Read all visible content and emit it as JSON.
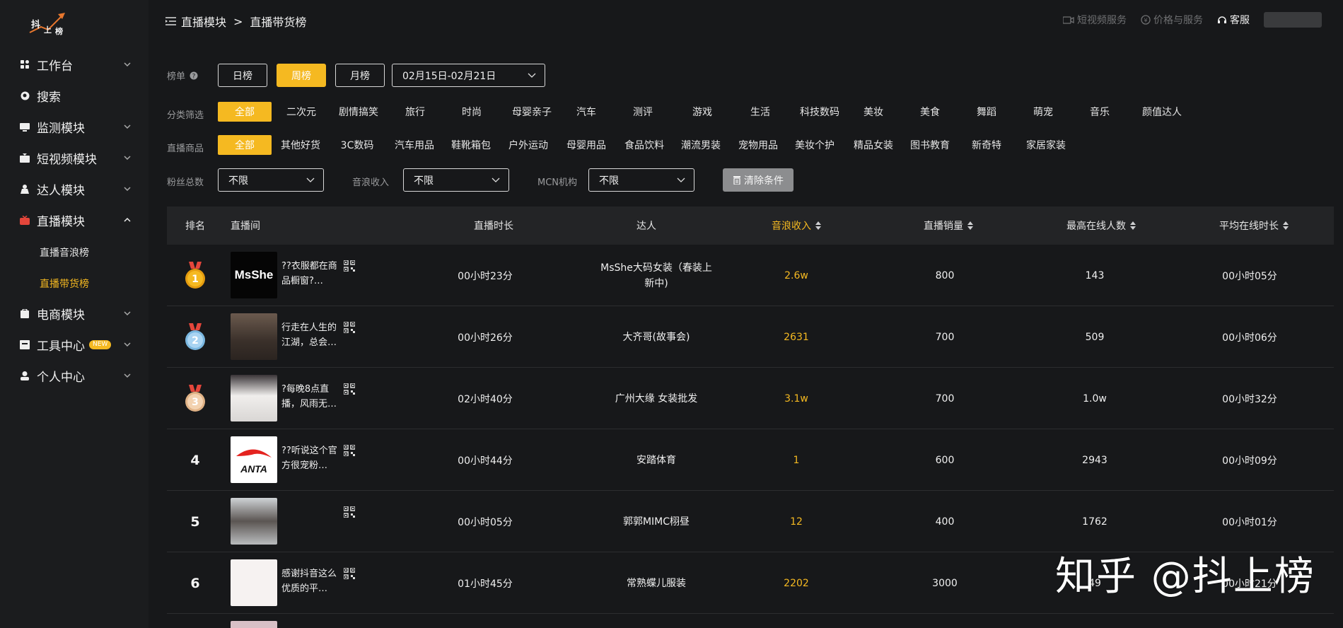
{
  "logo": {
    "line1": "抖",
    "line2": "上",
    "line3": "榜"
  },
  "sidebar": {
    "items": [
      {
        "label": "工作台",
        "icon": "grid-icon",
        "expanded": false
      },
      {
        "label": "搜索",
        "icon": "search-icon"
      },
      {
        "label": "监测模块",
        "icon": "monitor-icon",
        "expanded": false
      },
      {
        "label": "短视频模块",
        "icon": "video-icon",
        "expanded": false
      },
      {
        "label": "达人模块",
        "icon": "person-icon",
        "expanded": false
      },
      {
        "label": "直播模块",
        "icon": "tv-icon",
        "expanded": true
      },
      {
        "label": "电商模块",
        "icon": "shop-icon",
        "expanded": false
      },
      {
        "label": "工具中心",
        "icon": "tool-icon",
        "badge": "NEW",
        "expanded": false
      },
      {
        "label": "个人中心",
        "icon": "user-icon",
        "expanded": false
      }
    ],
    "subitems": [
      {
        "label": "直播音浪榜",
        "active": false
      },
      {
        "label": "直播带货榜",
        "active": true
      }
    ]
  },
  "header": {
    "breadcrumb": [
      "直播模块",
      "直播带货榜"
    ],
    "separator": ">",
    "links": [
      {
        "label": "短视频服务",
        "icon": "camera-icon"
      },
      {
        "label": "价格与服务",
        "icon": "yen-icon"
      },
      {
        "label": "客服",
        "icon": "headset-icon"
      }
    ]
  },
  "filters": {
    "board_label": "榜单",
    "periods": [
      {
        "label": "日榜",
        "active": false
      },
      {
        "label": "周榜",
        "active": true
      },
      {
        "label": "月榜",
        "active": false
      }
    ],
    "date_range": "02月15日-02月21日",
    "category_label": "分类筛选",
    "categories": [
      "全部",
      "二次元",
      "剧情搞笑",
      "旅行",
      "时尚",
      "母婴亲子",
      "汽车",
      "测评",
      "游戏",
      "生活",
      "科技数码",
      "美妆",
      "美食",
      "舞蹈",
      "萌宠",
      "音乐",
      "颜值达人"
    ],
    "goods_label": "直播商品",
    "goods": [
      "全部",
      "其他好货",
      "3C数码",
      "汽车用品",
      "鞋靴箱包",
      "户外运动",
      "母婴用品",
      "食品饮料",
      "潮流男装",
      "宠物用品",
      "美妆个护",
      "精品女装",
      "图书教育",
      "新奇特",
      "家居家装"
    ],
    "fans_label": "粉丝总数",
    "fans_value": "不限",
    "income_label": "音浪收入",
    "income_value": "不限",
    "mcn_label": "MCN机构",
    "mcn_value": "不限",
    "clear_label": "清除条件"
  },
  "table": {
    "columns": [
      "排名",
      "直播间",
      "直播时长",
      "达人",
      "音浪收入",
      "直播销量",
      "最高在线人数",
      "平均在线时长"
    ],
    "sorted_column": "音浪收入",
    "rows": [
      {
        "rank": "1",
        "medal": "gold",
        "title": "??衣服都在商品橱窗?…",
        "duration": "00小时23分",
        "streamer": "MsShe大码女装（春装上新中)",
        "income": "2.6w",
        "sales": "800",
        "peak": "143",
        "avg": "00小时05分",
        "thumb_text": "MsShe"
      },
      {
        "rank": "2",
        "medal": "silver",
        "title": "行走在人生的江湖，总会…",
        "duration": "00小时26分",
        "streamer": "大齐哥(故事会)",
        "income": "2631",
        "sales": "700",
        "peak": "509",
        "avg": "00小时06分",
        "thumb_text": ""
      },
      {
        "rank": "3",
        "medal": "bronze",
        "title": "?每晚8点直播，风雨无…",
        "duration": "02小时40分",
        "streamer": "广州大缘 女装批发",
        "income": "3.1w",
        "sales": "700",
        "peak": "1.0w",
        "avg": "00小时32分",
        "thumb_text": ""
      },
      {
        "rank": "4",
        "medal": "",
        "title": "??听说这个官方很宠粉…",
        "duration": "00小时44分",
        "streamer": "安踏体育",
        "income": "1",
        "sales": "600",
        "peak": "2943",
        "avg": "00小时09分",
        "thumb_text": "ANTA"
      },
      {
        "rank": "5",
        "medal": "",
        "title": "",
        "duration": "00小时05分",
        "streamer": "郭郭MIMC栩昼",
        "income": "12",
        "sales": "400",
        "peak": "1762",
        "avg": "00小时01分",
        "thumb_text": ""
      },
      {
        "rank": "6",
        "medal": "",
        "title": "感谢抖音这么优质的平…",
        "duration": "01小时45分",
        "streamer": "常熟蝶儿服装",
        "income": "2202",
        "sales": "3000",
        "peak": "49",
        "avg": "00小时21分",
        "thumb_text": ""
      }
    ]
  },
  "watermark": "知乎 @抖上榜",
  "colors": {
    "accent": "#f5b921",
    "background": "#17181a",
    "sidebar": "#1b1c1e",
    "table_header": "#232426"
  }
}
